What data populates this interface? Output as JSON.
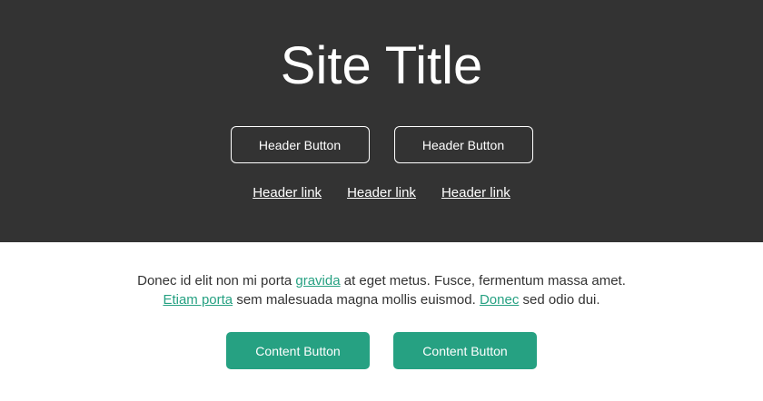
{
  "header": {
    "title": "Site Title",
    "buttons": [
      "Header Button",
      "Header Button"
    ],
    "links": [
      "Header link",
      "Header link",
      "Header link"
    ]
  },
  "content": {
    "paragraph": {
      "t1": "Donec id elit non mi porta ",
      "link1": "gravida",
      "t2": " at eget metus. Fusce, fermentum massa amet. ",
      "link2": "Etiam porta",
      "t3": " sem malesuada magna mollis euismod. ",
      "link3": "Donec",
      "t4": " sed odio dui."
    },
    "buttons": [
      "Content Button",
      "Content Button"
    ]
  },
  "colors": {
    "header_background": "#333333",
    "accent": "#26a182",
    "body_text": "#333333"
  }
}
